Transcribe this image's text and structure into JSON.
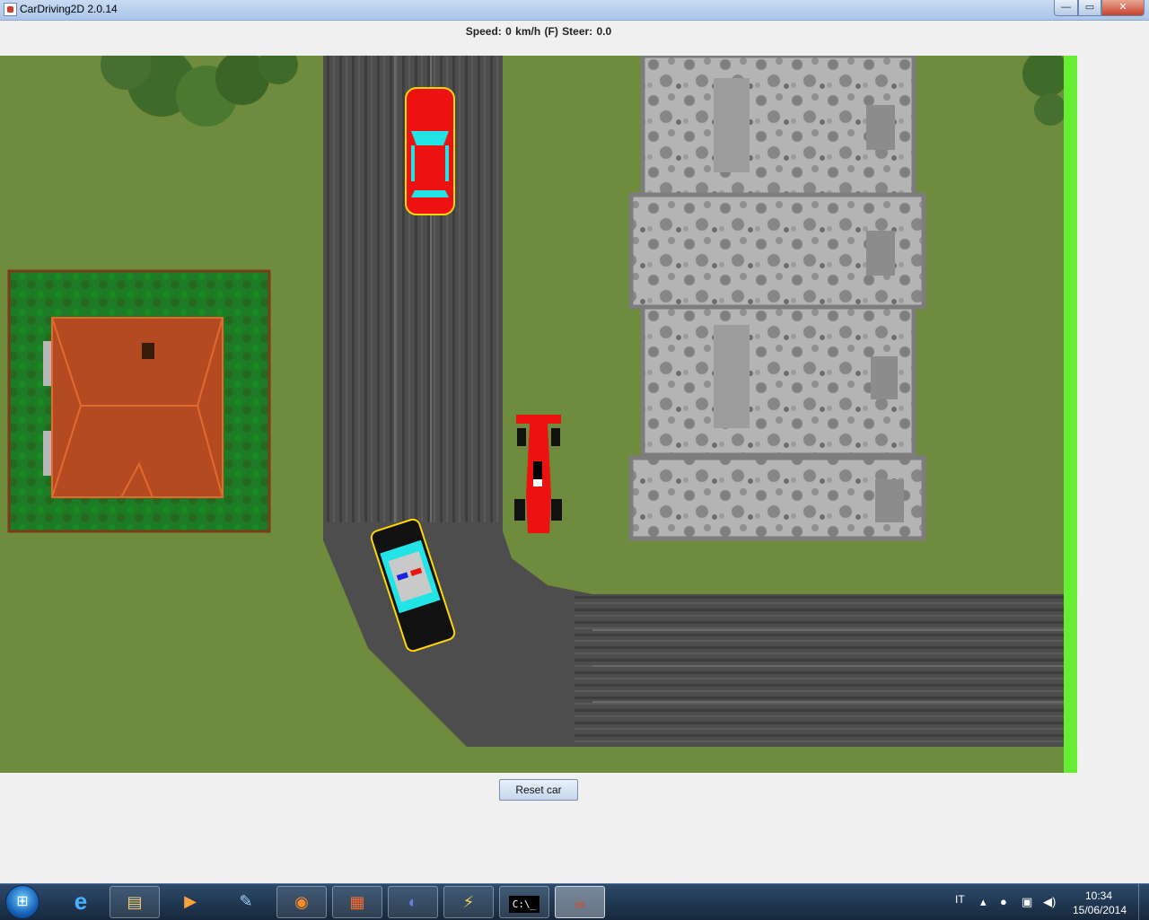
{
  "window": {
    "title": "CarDriving2D 2.0.14",
    "buttons": {
      "minimize": "—",
      "maximize": "▭",
      "close": "✕"
    }
  },
  "status_bar": {
    "text": "Speed:  0  km/h  (F)  Steer:  0.0"
  },
  "controls": {
    "reset_label": "Reset car"
  },
  "scene": {
    "colors": {
      "grass": "#6e8a3c",
      "road": "#4a4a4a",
      "house_lawn": "#1f7a26",
      "roof": "#b5491f",
      "building": "#a8a8a8",
      "boundary": "#66ee33",
      "car_red": "#ee1111",
      "windshield": "#22e3e6",
      "police_body": "#111111"
    },
    "objects": [
      "tree",
      "road",
      "house",
      "buildings",
      "red-car",
      "formula-car",
      "police-car"
    ]
  },
  "taskbar": {
    "apps": [
      {
        "name": "internet-explorer-icon",
        "glyph": "e"
      },
      {
        "name": "folder-icon",
        "glyph": "▤"
      },
      {
        "name": "media-player-icon",
        "glyph": "▶"
      },
      {
        "name": "paint-icon",
        "glyph": "✎"
      },
      {
        "name": "firefox-icon",
        "glyph": "◉"
      },
      {
        "name": "office-icon",
        "glyph": "▦"
      },
      {
        "name": "eclipse-icon",
        "glyph": "◐"
      },
      {
        "name": "tool-icon",
        "glyph": "⚡"
      },
      {
        "name": "cmd-icon",
        "glyph": "C:\\_"
      },
      {
        "name": "java-icon",
        "glyph": "☕"
      }
    ],
    "language": "IT",
    "time": "10:34",
    "date": "15/06/2014"
  }
}
